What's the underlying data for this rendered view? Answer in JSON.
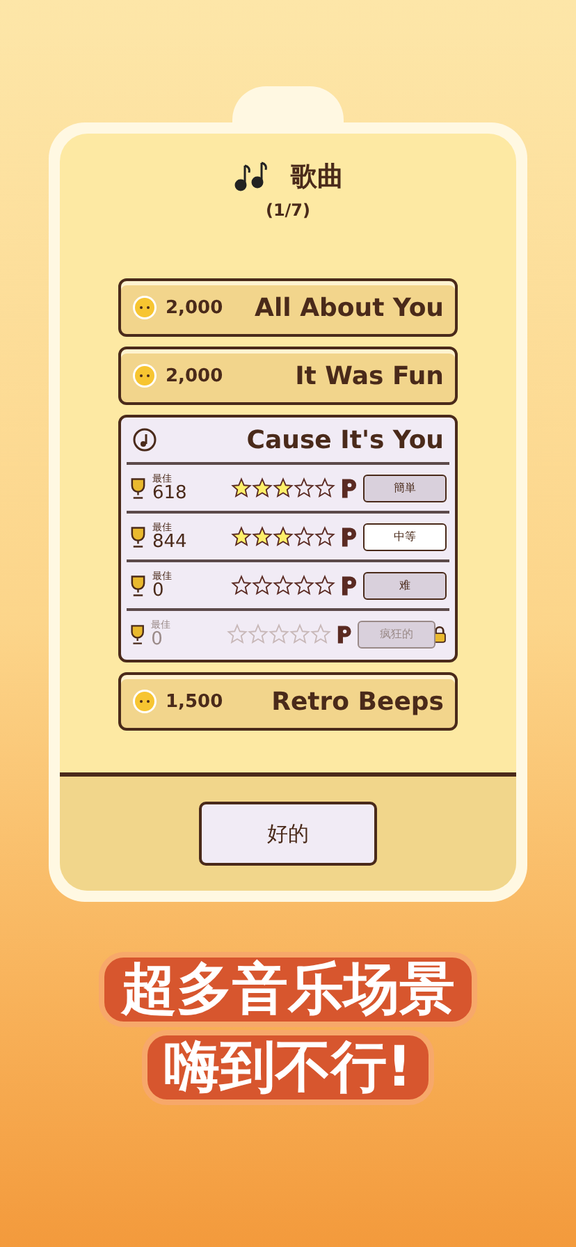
{
  "dialog": {
    "title": "歌曲",
    "page": "(1/7)"
  },
  "songs": [
    {
      "kind": "price",
      "price": "2,000",
      "title": "All About You"
    },
    {
      "kind": "price",
      "price": "2,000",
      "title": "It Was Fun"
    },
    {
      "kind": "open",
      "title": "Cause It's You",
      "levels": [
        {
          "best_label": "最佳",
          "score": "618",
          "stars": 3,
          "difficulty": "簡単",
          "locked": false,
          "selected": false
        },
        {
          "best_label": "最佳",
          "score": "844",
          "stars": 3,
          "difficulty": "中等",
          "locked": false,
          "selected": true
        },
        {
          "best_label": "最佳",
          "score": "0",
          "stars": 0,
          "difficulty": "难",
          "locked": false,
          "selected": false
        },
        {
          "best_label": "最佳",
          "score": "0",
          "stars": 0,
          "difficulty": "疯狂的",
          "locked": true,
          "selected": false
        }
      ]
    },
    {
      "kind": "price",
      "price": "1,500",
      "title": "Retro Beeps"
    }
  ],
  "ok_button": "好的",
  "banner": [
    "超多音乐场景",
    "嗨到不行!"
  ]
}
